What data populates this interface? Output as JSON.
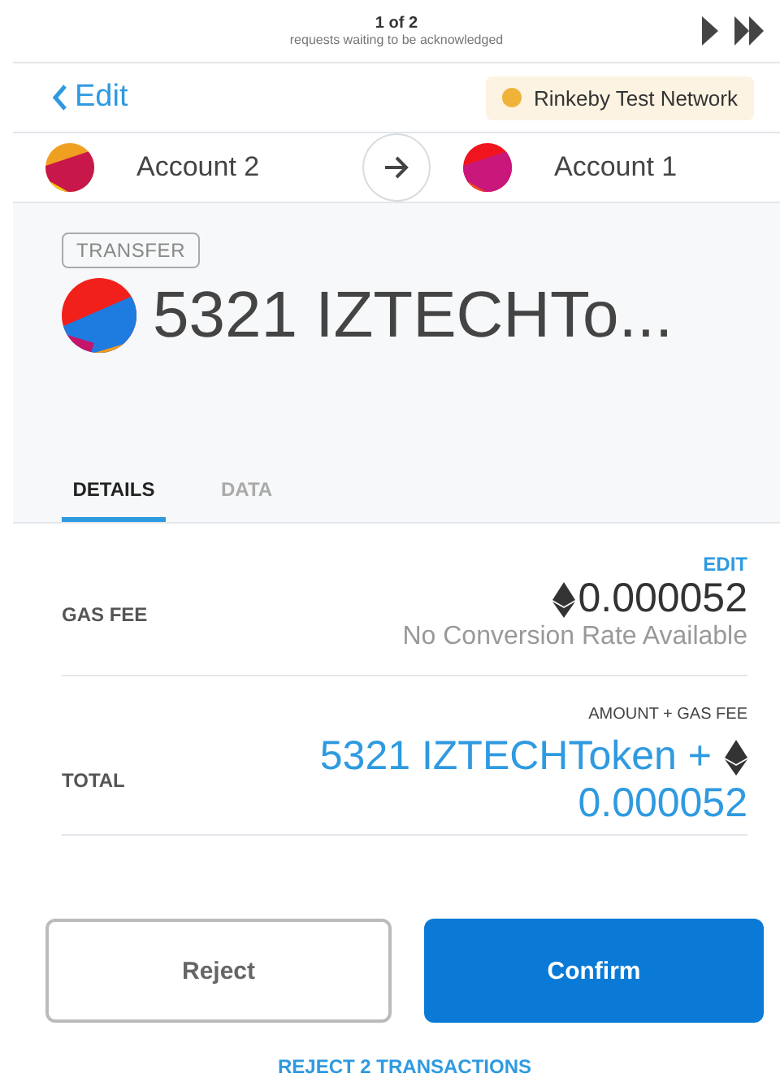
{
  "queue": {
    "position": "1 of 2",
    "subtitle": "requests waiting to be acknowledged"
  },
  "header": {
    "back": "Edit",
    "network": {
      "name": "Rinkeby Test Network",
      "color": "#f0b33a"
    }
  },
  "accounts": {
    "from": "Account 2",
    "to": "Account 1"
  },
  "transaction": {
    "type": "TRANSFER",
    "amount": "5321 IZTECHTo..."
  },
  "tabs": [
    {
      "label": "DETAILS",
      "selected": true
    },
    {
      "label": "DATA",
      "selected": false
    }
  ],
  "gas": {
    "edit": "EDIT",
    "label": "GAS FEE",
    "value": "0.000052",
    "conversion": "No Conversion Rate Available"
  },
  "total": {
    "heading": "AMOUNT + GAS FEE",
    "label": "TOTAL",
    "value_line1": "5321 IZTECHToken +",
    "value_line2": "0.000052"
  },
  "buttons": {
    "reject": "Reject",
    "confirm": "Confirm",
    "reject_all": "REJECT 2 TRANSACTIONS"
  }
}
